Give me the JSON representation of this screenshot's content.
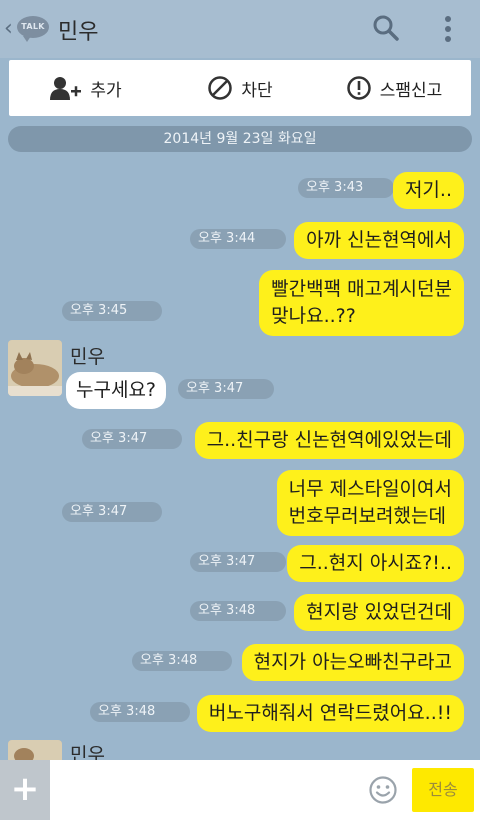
{
  "header": {
    "back_icon": "chevron-left-icon",
    "talk_icon_text": "TALK",
    "title": "민우",
    "search_icon": "search-icon",
    "more_icon": "more-vertical-icon"
  },
  "actions": {
    "add_label": "추가",
    "add_icon": "add-user-icon",
    "block_label": "차단",
    "block_icon": "block-icon",
    "spam_label": "스팸신고",
    "spam_icon": "warning-icon"
  },
  "date_divider": "2014년 9월 23일 화요일",
  "messages": [
    {
      "side": "right",
      "time": "오후 3:43",
      "lines": [
        "저기.."
      ]
    },
    {
      "side": "right",
      "time": "오후 3:44",
      "lines": [
        "아까 신논현역에서"
      ]
    },
    {
      "side": "right",
      "time": "오후 3:45",
      "lines": [
        "빨간백팩 매고계시던분",
        "맞나요..??"
      ]
    },
    {
      "side": "left",
      "sender": "민우",
      "time": "오후 3:47",
      "lines": [
        "누구세요?"
      ]
    },
    {
      "side": "right",
      "time": "오후 3:47",
      "lines": [
        "그..친구랑 신논현역에있었는데"
      ]
    },
    {
      "side": "right",
      "time": "오후 3:47",
      "lines": [
        "너무 제스타일이여서",
        "번호무러보려했는데"
      ]
    },
    {
      "side": "right",
      "time": "오후 3:47",
      "lines": [
        "그..현지 아시죠?!.."
      ]
    },
    {
      "side": "right",
      "time": "오후 3:48",
      "lines": [
        "현지랑 있었던건데"
      ]
    },
    {
      "side": "right",
      "time": "오후 3:48",
      "lines": [
        "현지가 아는오빠친구라고"
      ]
    },
    {
      "side": "right",
      "time": "오후 3:48",
      "lines": [
        "버노구해줘서 연락드렸어요..!!"
      ]
    }
  ],
  "partial_sender": "민우",
  "bottom": {
    "plus_label": "+",
    "input_value": "",
    "input_placeholder": "",
    "emoji_icon": "smiley-icon",
    "send_label": "전송"
  },
  "colors": {
    "background": "#9bb6cc",
    "my_bubble": "#fef01b",
    "their_bubble": "#ffffff",
    "send_button": "#fee900"
  }
}
